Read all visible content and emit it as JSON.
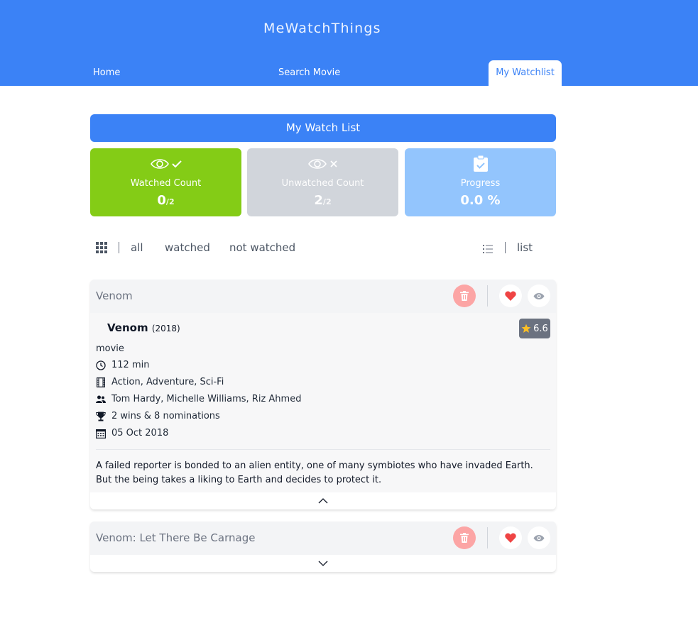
{
  "app": {
    "title": "MeWatchThings"
  },
  "nav": {
    "home": "Home",
    "search": "Search Movie",
    "watchlist": "My Watchlist"
  },
  "section": {
    "title": "My Watch List"
  },
  "stats": {
    "watched": {
      "label": "Watched Count",
      "value": "0",
      "total": "/2",
      "color": "#84cc16"
    },
    "unwatched": {
      "label": "Unwatched Count",
      "value": "2",
      "total": "/2",
      "color": "#d1d5db"
    },
    "progress": {
      "label": "Progress",
      "value": "0.0 %",
      "color": "#93c5fd"
    }
  },
  "filters": {
    "all": "all",
    "watched": "watched",
    "not_watched": "not watched",
    "view_mode": "list"
  },
  "movies": [
    {
      "title": "Venom",
      "name": "Venom",
      "year": "(2018)",
      "rating": "6.6",
      "type": "movie",
      "runtime": "112 min",
      "genre": "Action, Adventure, Sci-Fi",
      "actors": "Tom Hardy, Michelle Williams, Riz Ahmed",
      "awards": "2 wins & 8 nominations",
      "released": "05 Oct 2018",
      "plot": "A failed reporter is bonded to an alien entity, one of many symbiotes who have invaded Earth. But the being takes a liking to Earth and decides to protect it."
    },
    {
      "title": "Venom: Let There Be Carnage"
    }
  ],
  "colors": {
    "brand": "#3b82f6",
    "delete": "#fca5a5",
    "favorite": "#ef4444",
    "badge": "#6b7280"
  }
}
